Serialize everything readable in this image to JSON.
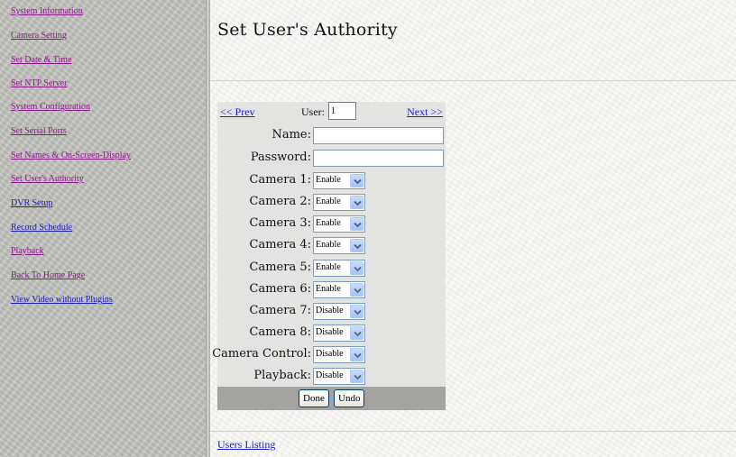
{
  "sidebar": {
    "items": [
      {
        "label": "System Information"
      },
      {
        "label": "Camera Setting"
      },
      {
        "label": "Set Date & Time"
      },
      {
        "label": "Set NTP Server"
      },
      {
        "label": "System Configuration"
      },
      {
        "label": "Set Serial Ports"
      },
      {
        "label": "Set Names & On-Screen-Display"
      },
      {
        "label": "Set User's Authority"
      },
      {
        "label": "DVR Setup"
      },
      {
        "label": "Record Schedule"
      },
      {
        "label": "Playback"
      },
      {
        "label": "Back To Home Page"
      },
      {
        "label": "View Video without Plugins"
      }
    ],
    "colors": {
      "visited_link": "#8a1a8a",
      "link": "#1d1db8"
    }
  },
  "main": {
    "title": "Set User's Authority",
    "nav": {
      "prev_label": "<< Prev",
      "next_label": "Next >>",
      "user_label": "User:",
      "user_value": "1"
    },
    "fields": {
      "name_label": "Name:",
      "password_label": "Password:"
    },
    "permissions": [
      {
        "label": "Camera 1:",
        "value": "Enable"
      },
      {
        "label": "Camera 2:",
        "value": "Enable"
      },
      {
        "label": "Camera 3:",
        "value": "Enable"
      },
      {
        "label": "Camera 4:",
        "value": "Enable"
      },
      {
        "label": "Camera 5:",
        "value": "Enable"
      },
      {
        "label": "Camera 6:",
        "value": "Enable"
      },
      {
        "label": "Camera 7:",
        "value": "Disable"
      },
      {
        "label": "Camera 8:",
        "value": "Disable"
      },
      {
        "label": "Camera Control:",
        "value": "Disable"
      },
      {
        "label": "Playback:",
        "value": "Disable"
      }
    ],
    "buttons": {
      "done_label": "Done",
      "undo_label": "Undo"
    },
    "users_listing_label": "Users Listing"
  },
  "icons": {
    "dropdown": "chevron-down-icon"
  }
}
